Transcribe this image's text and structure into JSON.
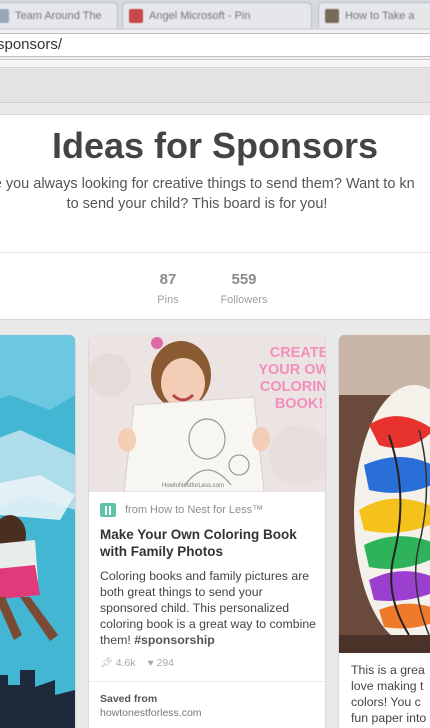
{
  "browser": {
    "tabs": [
      {
        "label": "Team Around The",
        "color": "#9aa6b8"
      },
      {
        "label": "Angel Microsoft - Pin",
        "color": "#c64a4a"
      },
      {
        "label": "How to Take a",
        "color": "#7a6a5a"
      }
    ],
    "url": "sponsors/"
  },
  "board": {
    "title": "Ideas for Sponsors",
    "description_line1": "Are you always looking for creative things to send them? Want to kn",
    "description_line2": "to send your child? This board is for you!",
    "stats": [
      {
        "number": "87",
        "label": "Pins"
      },
      {
        "number": "559",
        "label": "Followers"
      }
    ]
  },
  "pins": {
    "middle": {
      "image_text": "CREATE YOUR OWN COLORING BOOK!",
      "image_caption": "HowtoNestforLess.com",
      "source": "from How to Nest for Less™",
      "title": "Make Your Own Coloring Book with Family Photos",
      "description": "Coloring books and family pictures are both great things to send your sponsored child. This personalized coloring book is a great way to combine them!",
      "hashtag": "#sponsorship",
      "repins": "4.6k",
      "likes": "294",
      "saved_label": "Saved from",
      "saved_source": "howtonestforless.com"
    },
    "right": {
      "desc_line1": "This is a grea",
      "desc_line2": "love making t",
      "desc_line3": "colors! You c",
      "desc_line4": "fun paper into"
    }
  }
}
